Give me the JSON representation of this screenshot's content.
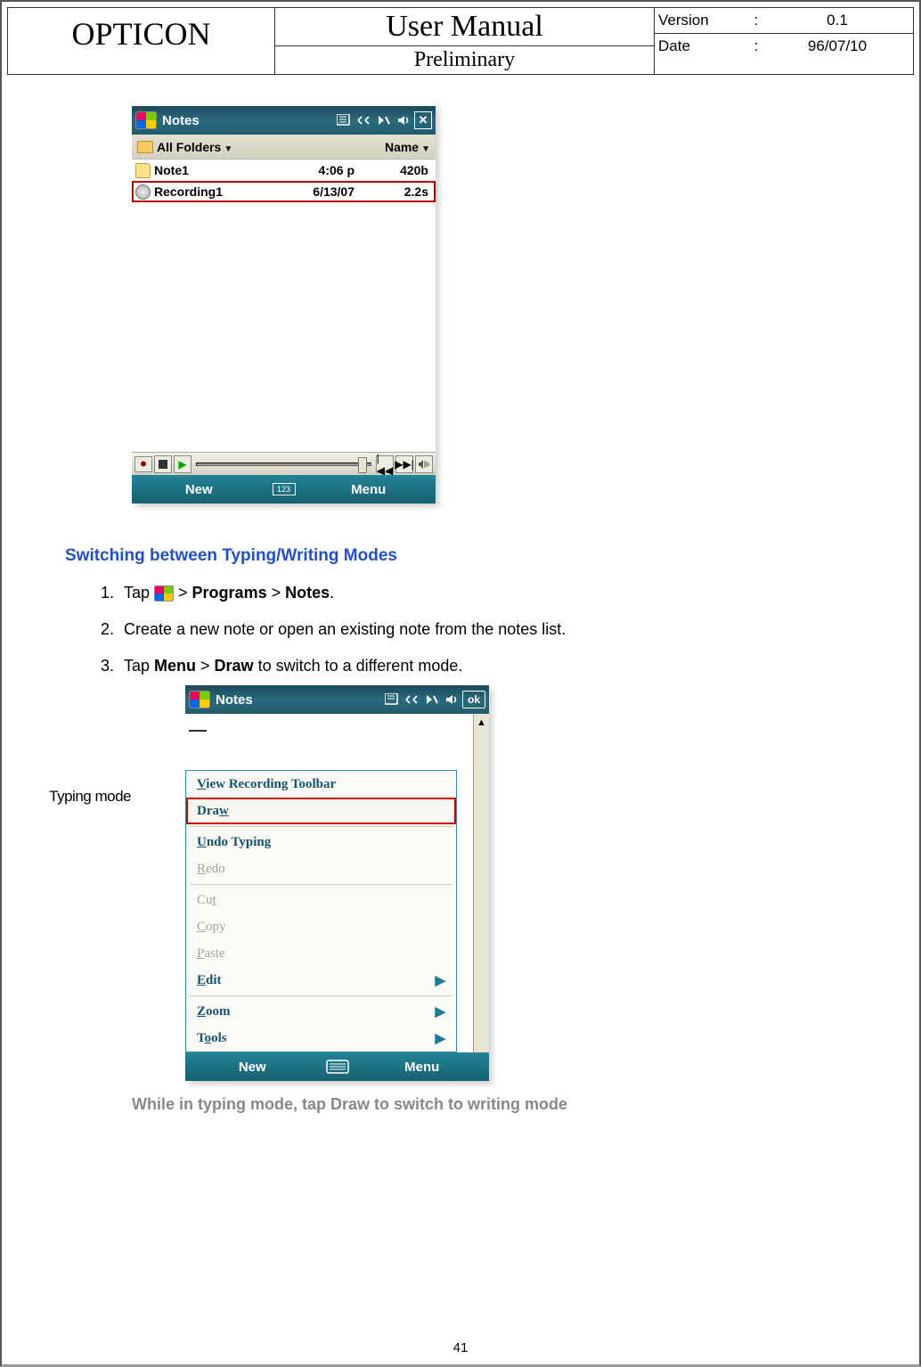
{
  "header": {
    "brand": "OPTICON",
    "title": "User Manual",
    "subtitle": "Preliminary",
    "version_label": "Version",
    "version_value": "0.1",
    "date_label": "Date",
    "date_value": "96/07/10",
    "sep": ":"
  },
  "screenshot1": {
    "title": "Notes",
    "folders": "All Folders",
    "name_col": "Name",
    "rows": [
      {
        "name": "Note1",
        "time": "4:06 p",
        "size": "420b",
        "type": "note"
      },
      {
        "name": "Recording1",
        "time": "6/13/07",
        "size": "2.2s",
        "type": "rec"
      }
    ],
    "menubar": {
      "new": "New",
      "keyboard": "123",
      "menu": "Menu"
    }
  },
  "section_title": "Switching between Typing/Writing Modes",
  "steps": {
    "s1a": "Tap ",
    "s1b": " > ",
    "s1c": "Programs",
    "s1d": " > ",
    "s1e": "Notes",
    "s1f": ".",
    "s2": "Create a new note or open an existing note from the notes list.",
    "s3a": "Tap ",
    "s3b": "Menu",
    "s3c": " > ",
    "s3d": "Draw",
    "s3e": " to switch to a different mode."
  },
  "screenshot2": {
    "typing_label": "Typing mode",
    "title": "Notes",
    "ok": "ok",
    "menu_items": {
      "view_toolbar": "iew Recording Toolbar",
      "view_toolbar_u": "V",
      "draw": "Dra",
      "draw_u": "w",
      "undo": "ndo Typing",
      "undo_u": "U",
      "redo": "edo",
      "redo_u": "R",
      "cut": "Cu",
      "cut_u": "t",
      "copy": "opy",
      "copy_u": "C",
      "paste": "aste",
      "paste_u": "P",
      "edit": "dit",
      "edit_u": "E",
      "zoom": "oom",
      "zoom_u": "Z",
      "tools": "T",
      "tools_rest": "ols",
      "tools_u": "o"
    },
    "menubar": {
      "new": "New",
      "menu": "Menu"
    }
  },
  "caption": "While in typing mode, tap Draw to switch to writing mode",
  "page_number": "41"
}
